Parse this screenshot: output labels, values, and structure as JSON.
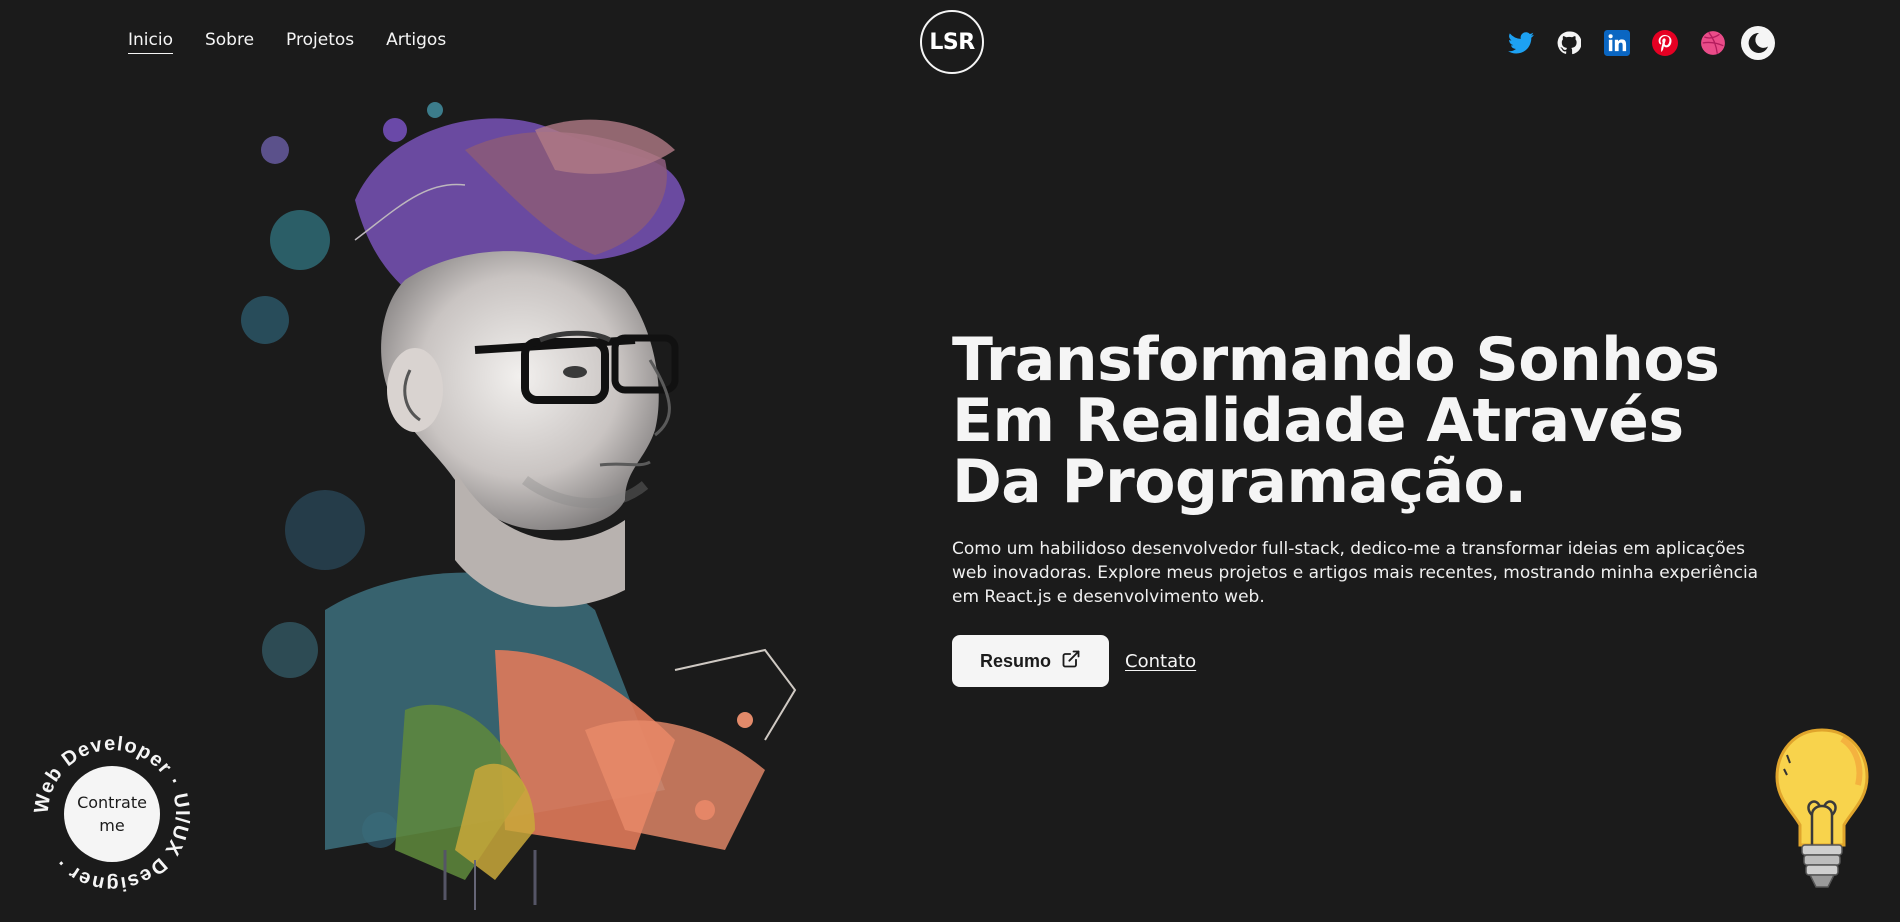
{
  "nav": {
    "items": [
      {
        "label": "Inicio",
        "active": true
      },
      {
        "label": "Sobre",
        "active": false
      },
      {
        "label": "Projetos",
        "active": false
      },
      {
        "label": "Artigos",
        "active": false
      }
    ]
  },
  "logo": {
    "text": "LSR"
  },
  "social": {
    "icons": [
      "twitter-icon",
      "github-icon",
      "linkedin-icon",
      "pinterest-icon",
      "dribbble-icon",
      "moon-icon"
    ]
  },
  "hero": {
    "title": "Transformando Sonhos Em Realidade Através Da Programação.",
    "description": "Como um habilidoso desenvolvedor full-stack, dedico-me a transformar ideias em aplicações web inovadoras. Explore meus projetos e artigos mais recentes, mostrando minha experiência em React.js e desenvolvimento web.",
    "resume_label": "Resumo",
    "contact_label": "Contato"
  },
  "hire": {
    "ring_text": "Web Developer · UI/UX Designer · ",
    "center_label": "Contrate me"
  },
  "colors": {
    "background": "#1b1b1b",
    "text": "#f5f5f5",
    "twitter": "#1DA1F2",
    "linkedin": "#0A66C2",
    "pinterest": "#E60023",
    "dribbble": "#EA4C89",
    "bulb": "#F8D34C"
  }
}
